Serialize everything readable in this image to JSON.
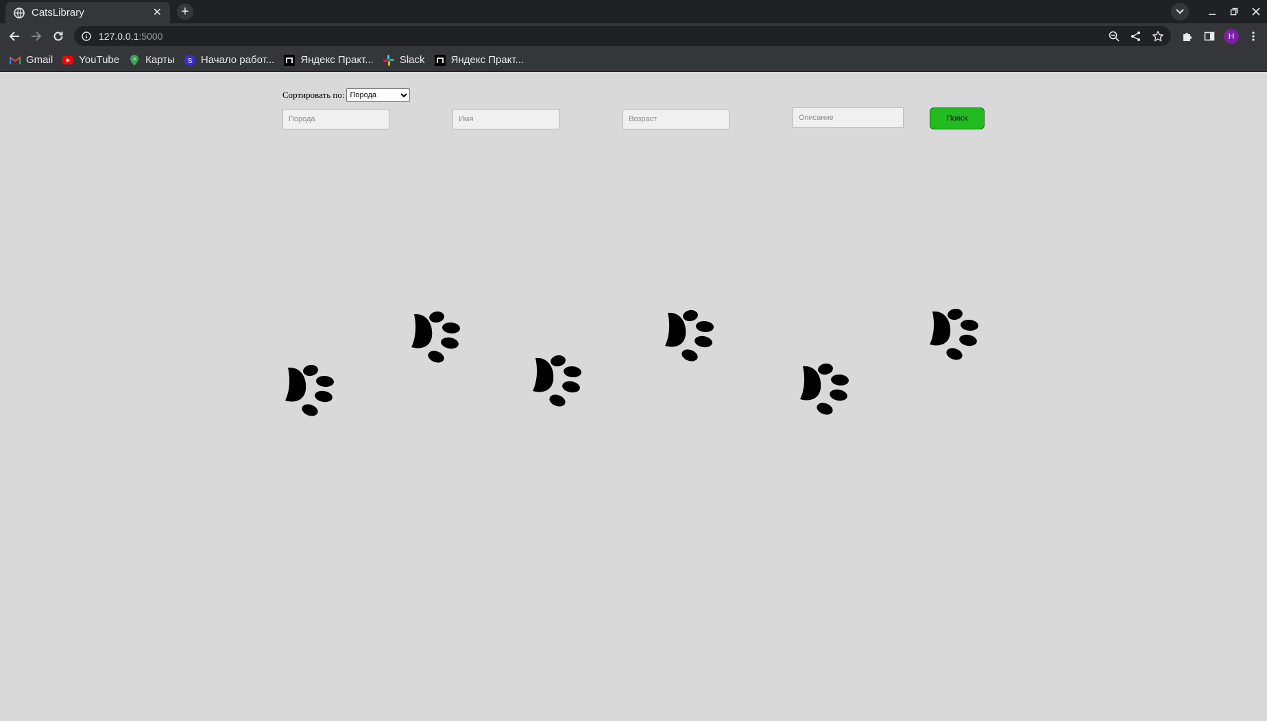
{
  "browser": {
    "tab_title": "CatsLibrary",
    "url_host": "127.0.0.1",
    "url_port": ":5000",
    "profile_initial": "Н"
  },
  "bookmarks": [
    {
      "label": "Gmail",
      "icon": "gmail-icon"
    },
    {
      "label": "YouTube",
      "icon": "youtube-icon"
    },
    {
      "label": "Карты",
      "icon": "maps-icon"
    },
    {
      "label": "Начало работ...",
      "icon": "s-icon"
    },
    {
      "label": "Яндекс Практ...",
      "icon": "yandex-practicum-icon"
    },
    {
      "label": "Slack",
      "icon": "slack-icon"
    },
    {
      "label": "Яндекс Практ...",
      "icon": "yandex-practicum-icon"
    }
  ],
  "page": {
    "sort_label": "Сортировать по:",
    "sort_selected": "Порода",
    "filters": {
      "breed_placeholder": "Порода",
      "name_placeholder": "Имя",
      "age_placeholder": "Возраст",
      "description_placeholder": "Описание"
    },
    "search_button": "Поиск",
    "decoration": "paw-print-icon"
  },
  "colors": {
    "page_background": "#d9d9d9",
    "search_button": "#22bb22",
    "chrome_dark": "#202124",
    "chrome_toolbar": "#35363a"
  }
}
